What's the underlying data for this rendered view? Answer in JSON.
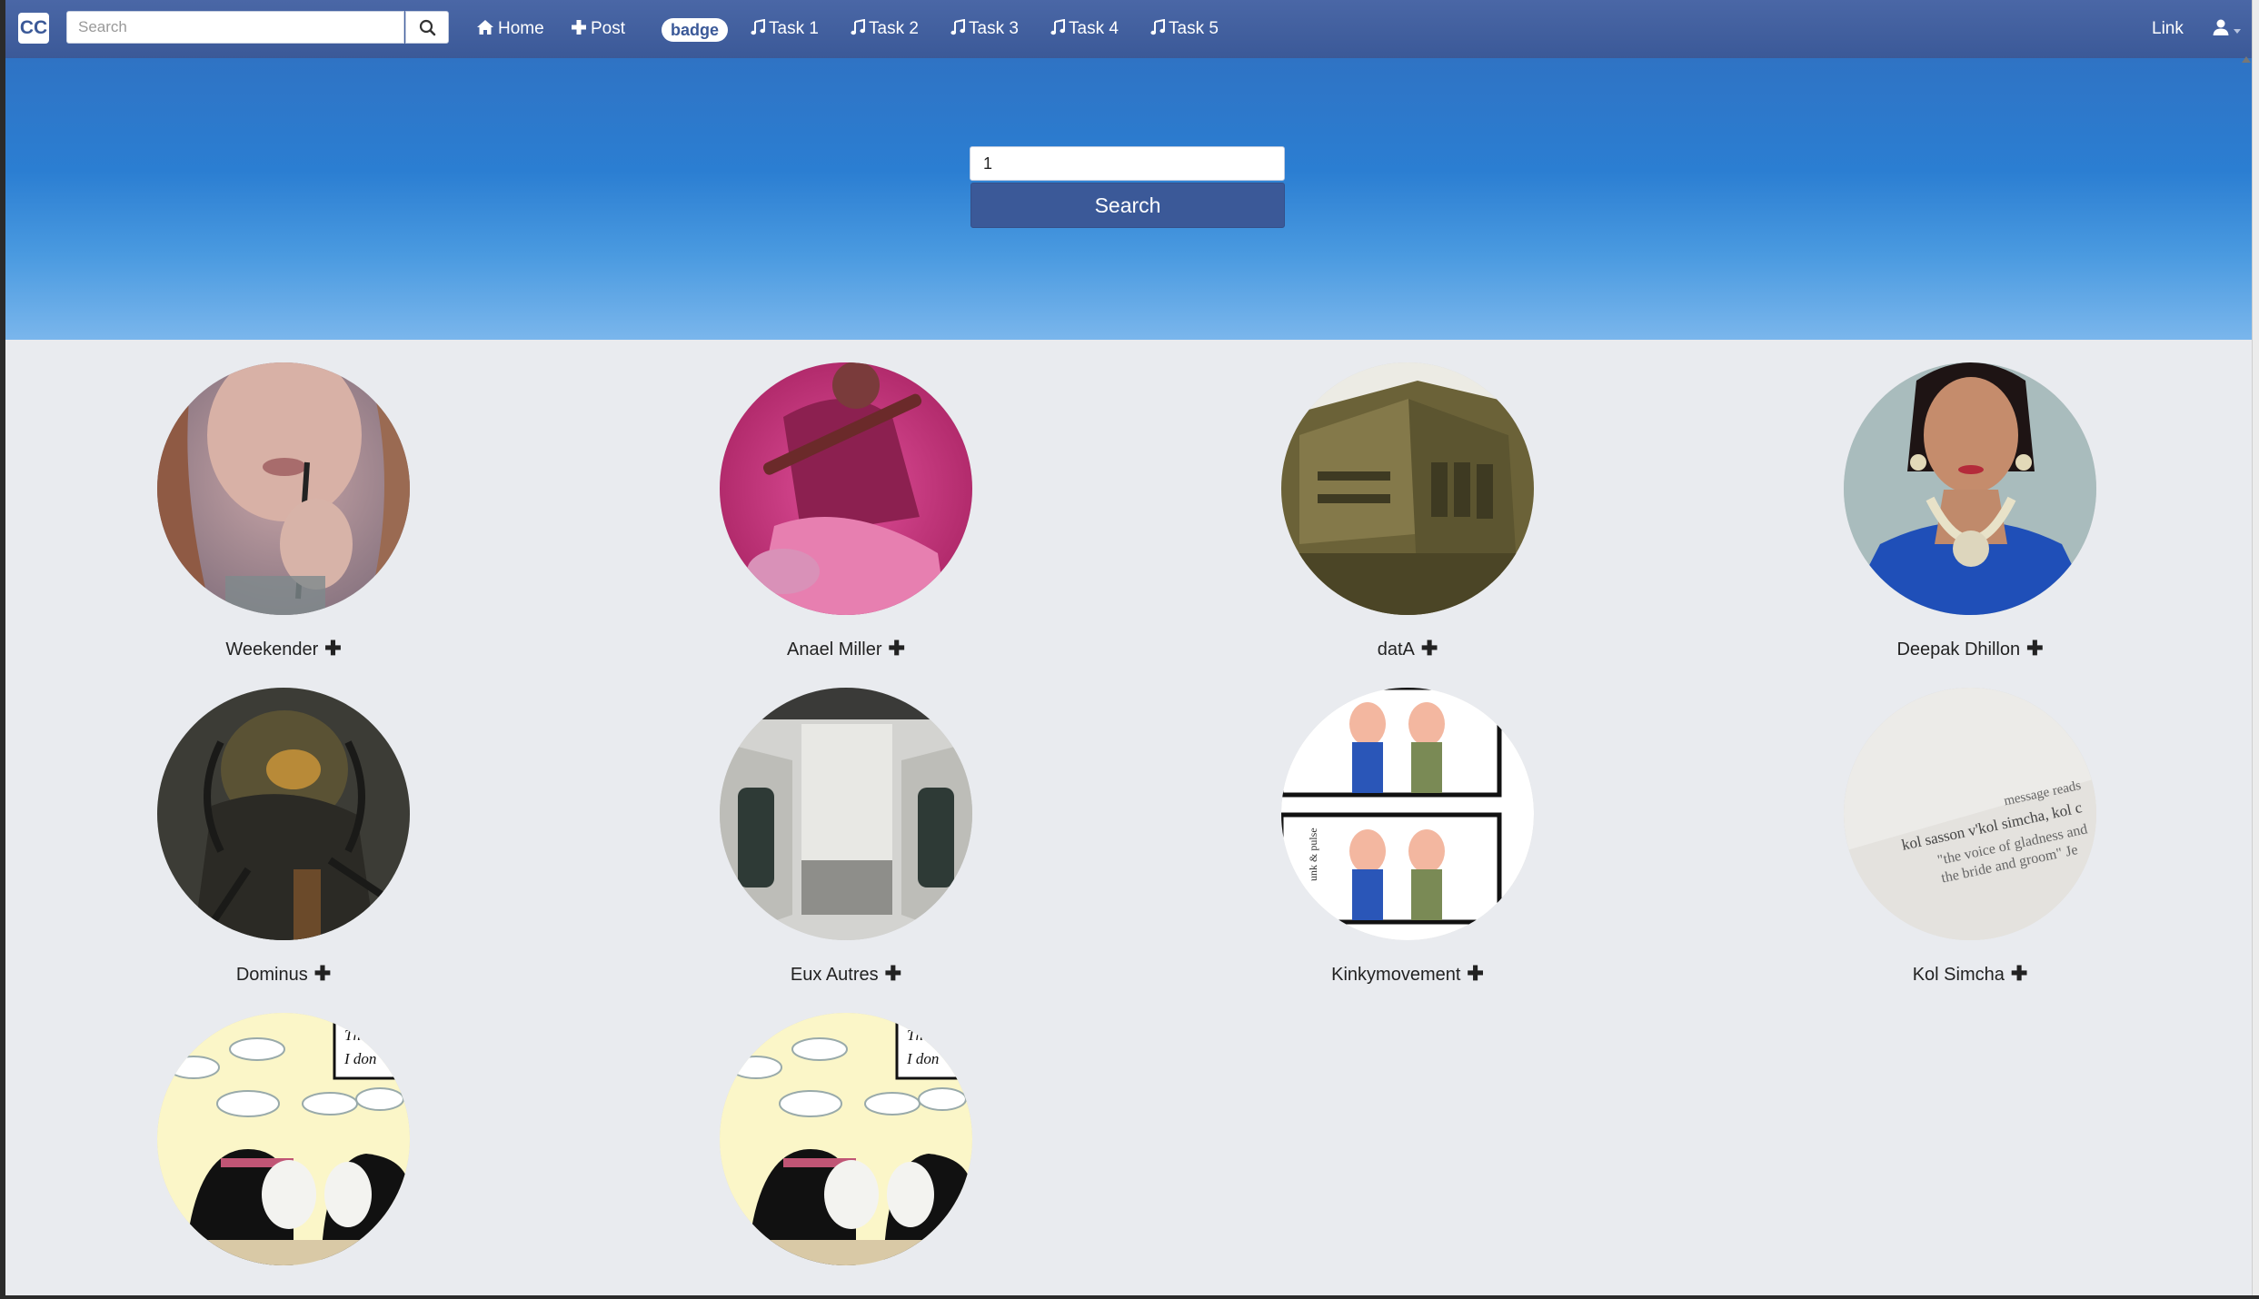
{
  "navbar": {
    "brand": "CC",
    "search_placeholder": "Search",
    "items": [
      {
        "label": "Home",
        "icon": "home-icon"
      },
      {
        "label": "Post",
        "icon": "plus-icon"
      },
      {
        "label": "Task 1",
        "icon": "music-icon"
      },
      {
        "label": "Task 2",
        "icon": "music-icon"
      },
      {
        "label": "Task 3",
        "icon": "music-icon"
      },
      {
        "label": "Task 4",
        "icon": "music-icon"
      },
      {
        "label": "Task 5",
        "icon": "music-icon"
      }
    ],
    "badge": "badge",
    "link": "Link",
    "user_icon": "user-icon"
  },
  "hero": {
    "search_value": "1",
    "search_button": "Search"
  },
  "users": [
    {
      "name": "Weekender",
      "add": "✚"
    },
    {
      "name": "Anael Miller",
      "add": "✚"
    },
    {
      "name": "datA",
      "add": "✚"
    },
    {
      "name": "Deepak Dhillon",
      "add": "✚"
    },
    {
      "name": "Dominus",
      "add": "✚"
    },
    {
      "name": "Eux Autres",
      "add": "✚"
    },
    {
      "name": "Kinkymovement",
      "add": "✚"
    },
    {
      "name": "Kol Simcha",
      "add": "✚"
    },
    {
      "name": "",
      "add": ""
    },
    {
      "name": "",
      "add": ""
    }
  ],
  "image_text": {
    "kol_line1": "message reads",
    "kol_line2": "kol sasson v'kol simcha, kol c",
    "kol_line3": "\"the voice of gladness and",
    "kol_line4": "the bride and groom\" Je",
    "comic_line1": "Th",
    "comic_line2": "I don",
    "strip_side": "unk & pulse"
  },
  "colors": {
    "navbar": "#3b5998",
    "hero_top": "#2f73c4",
    "hero_bottom": "#7ab6ec",
    "page_bg": "#e9ebef"
  }
}
